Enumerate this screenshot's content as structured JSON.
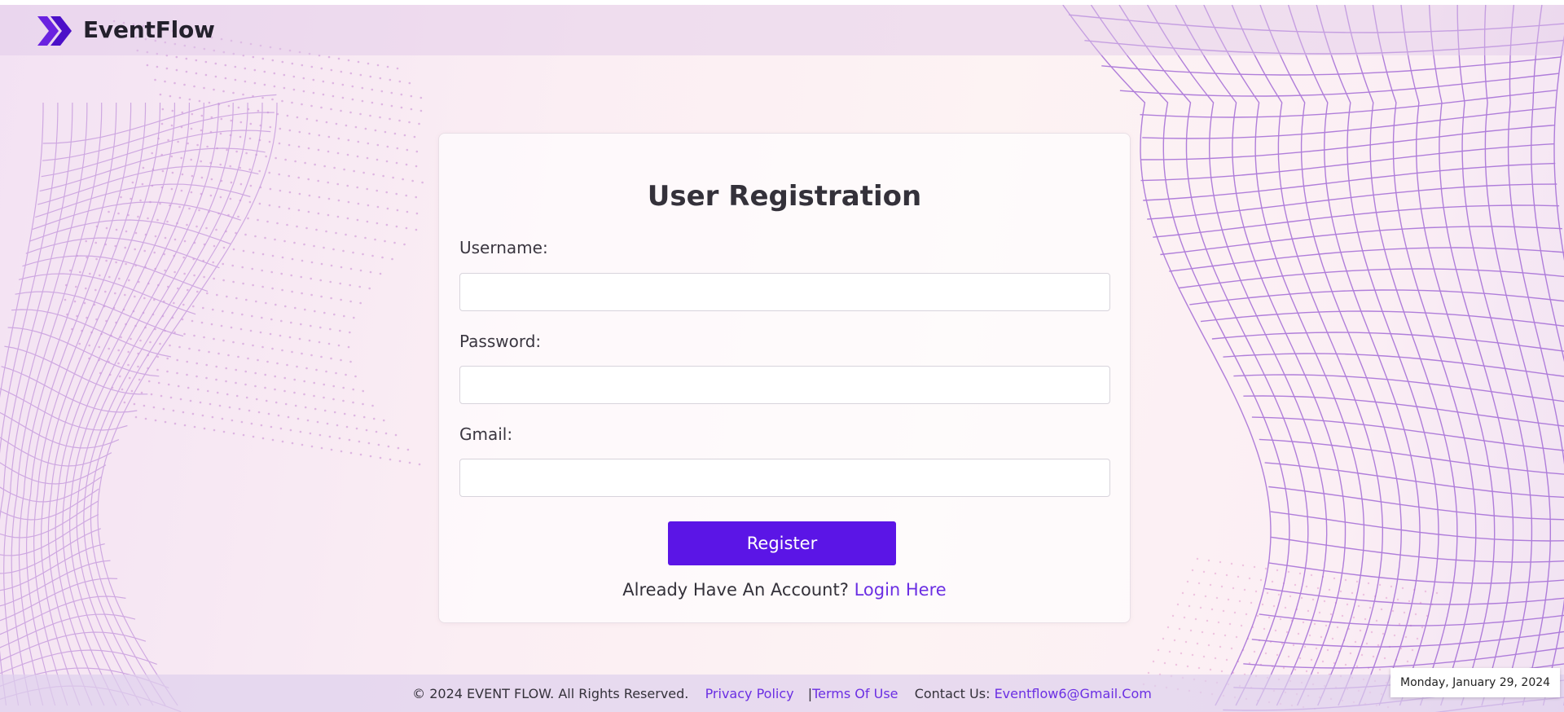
{
  "header": {
    "brand": "EventFlow",
    "logo_icon": "chevron-arrow-icon",
    "accent_color": "#5b15e6"
  },
  "form": {
    "title": "User Registration",
    "fields": [
      {
        "label": "Username:",
        "value": "",
        "placeholder": ""
      },
      {
        "label": "Password:",
        "value": "",
        "placeholder": ""
      },
      {
        "label": "Gmail:",
        "value": "",
        "placeholder": ""
      }
    ],
    "register_label": "Register",
    "account_prompt": "Already Have An Account?",
    "login_link": "Login Here"
  },
  "footer": {
    "copyright": "© 2024 EVENT FLOW. All Rights Reserved.",
    "privacy": "Privacy Policy",
    "separator": "|",
    "terms": "Terms Of Use",
    "contact_label": "Contact Us:",
    "contact_email": "Eventflow6@Gmail.Com"
  },
  "date_badge": "Monday, January 29, 2024",
  "colors": {
    "primary_button": "#5b15e6",
    "link": "#6b2fe3",
    "mesh_purple": "#a36bd6",
    "mesh_pink": "#e59acb"
  }
}
